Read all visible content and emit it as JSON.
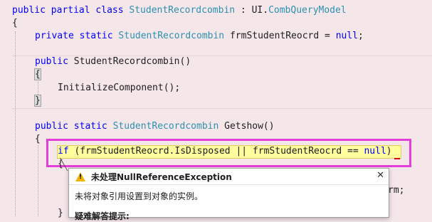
{
  "code": {
    "line1": {
      "kw1": "public",
      "kw2": "partial",
      "kw3": "class",
      "type": "StudentRecordcombin",
      "sep": " : UI.",
      "base": "CombQueryModel"
    },
    "line2": "{",
    "line3": {
      "kw1": "private",
      "kw2": "static",
      "type": "StudentRecordcombin",
      "rest": " frmStudentReocrd = ",
      "null": "null",
      "end": ";"
    },
    "line5": {
      "kw": "public",
      "rest": " StudentRecordcombin()"
    },
    "line6": "{",
    "line7": "InitializeComponent();",
    "line8": "}",
    "line10": {
      "kw1": "public",
      "kw2": "static",
      "type": "StudentRecordcombin",
      "rest": " Getshow()"
    },
    "line11": "{",
    "line12": {
      "kw": "if",
      "rest": " (frmStudentReocrd.IsDisposed || frmStudentReocrd == ",
      "null": "null",
      "end": ")"
    },
    "line13": "{",
    "line14_tail": "rm;",
    "line15": "}"
  },
  "exception_popup": {
    "title": "未处理NullReferenceException",
    "message": "未将对象引用设置到对象的实例。",
    "section": "疑难解答提示:",
    "close_glyph": "✕",
    "warning_glyph": "!"
  },
  "colors": {
    "keyword": "#0000ff",
    "type": "#2b91af",
    "highlight": "#fffd9e",
    "focus_box": "#e23fd6",
    "editor_background": "#f5e6ea"
  }
}
